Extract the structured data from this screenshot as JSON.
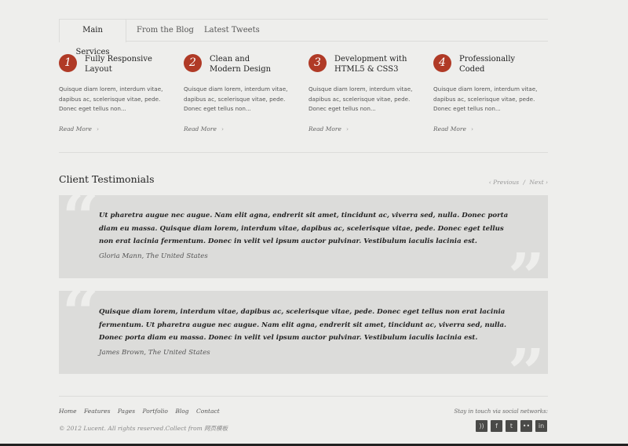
{
  "tabs": [
    {
      "label": "Main Services"
    },
    {
      "label": "From the Blog"
    },
    {
      "label": "Latest Tweets"
    }
  ],
  "services": [
    {
      "number": "1",
      "title_line1": "Fully Responsive",
      "title_line2": "Layout",
      "desc": "Quisque diam lorem, interdum vitae, dapibus ac, scelerisque vitae, pede. Donec eget tellus non...",
      "read_more": "Read More"
    },
    {
      "number": "2",
      "title_line1": "Clean and",
      "title_line2": "Modern Design",
      "desc": "Quisque diam lorem, interdum vitae, dapibus ac, scelerisque vitae, pede. Donec eget tellus non...",
      "read_more": "Read More"
    },
    {
      "number": "3",
      "title_line1": "Development with",
      "title_line2": "HTML5 & CSS3",
      "desc": "Quisque diam lorem, interdum vitae, dapibus ac, scelerisque vitae, pede. Donec eget tellus non...",
      "read_more": "Read More"
    },
    {
      "number": "4",
      "title_line1": "Professionally",
      "title_line2": "Coded",
      "desc": "Quisque diam lorem, interdum vitae, dapibus ac, scelerisque vitae, pede. Donec eget tellus non...",
      "read_more": "Read More"
    }
  ],
  "testimonials_section": {
    "title": "Client Testimonials",
    "previous": "Previous",
    "separator": "/",
    "next": "Next"
  },
  "testimonials": [
    {
      "text": "Ut pharetra augue nec augue. Nam elit agna, endrerit sit amet, tincidunt ac, viverra sed, nulla. Donec porta diam eu massa. Quisque diam lorem, interdum vitae, dapibus ac, scelerisque vitae, pede. Donec eget tellus non erat lacinia fermentum. Donec in velit vel ipsum auctor pulvinar. Vestibulum iaculis lacinia est.",
      "author": "Gloria Mann, The United States"
    },
    {
      "text": "Quisque diam lorem, interdum vitae, dapibus ac, scelerisque vitae, pede. Donec eget tellus non erat lacinia fermentum. Ut pharetra augue nec augue. Nam elit agna, endrerit sit amet, tincidunt ac, viverra sed, nulla. Donec porta diam eu massa. Donec in velit vel ipsum auctor pulvinar. Vestibulum iaculis lacinia est.",
      "author": "James Brown, The United States"
    }
  ],
  "footer": {
    "nav": [
      "Home",
      "Features",
      "Pages",
      "Portfolio",
      "Blog",
      "Contact"
    ],
    "copyright": "© 2012 Lucent. All rights reserved.Collect from 网页模板",
    "social_label": "Stay in touch via social networks:",
    "social_icons": [
      {
        "name": "rss-icon",
        "glyph": "))"
      },
      {
        "name": "facebook-icon",
        "glyph": "f"
      },
      {
        "name": "twitter-icon",
        "glyph": "t"
      },
      {
        "name": "flickr-icon",
        "glyph": "••"
      },
      {
        "name": "linkedin-icon",
        "glyph": "in"
      }
    ]
  },
  "colors": {
    "accent": "#b03a26",
    "background": "#eeeeec",
    "panel": "#dcdcda"
  }
}
